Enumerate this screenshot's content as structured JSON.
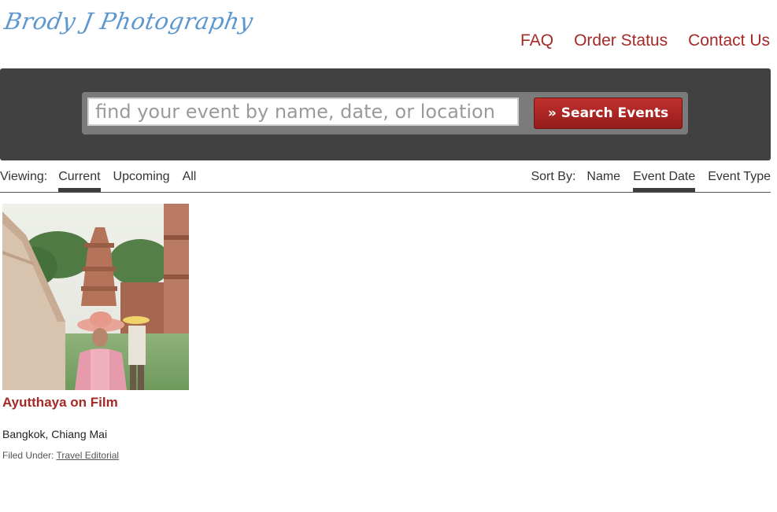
{
  "header": {
    "logo_text": "Brody J Photography",
    "nav": [
      "FAQ",
      "Order Status",
      "Contact Us"
    ]
  },
  "search": {
    "placeholder": "find your event by name, date, or location",
    "button_label": "» Search Events"
  },
  "filters": {
    "viewing_label": "Viewing:",
    "viewing_options": [
      "Current",
      "Upcoming",
      "All"
    ],
    "viewing_active": "Current",
    "sort_label": "Sort By:",
    "sort_options": [
      "Name",
      "Event Date",
      "Event Type"
    ],
    "sort_active": "Event Date"
  },
  "events": [
    {
      "title": "Ayutthaya on Film",
      "location": "Bangkok, Chiang Mai",
      "filed_label": "Filed Under:",
      "category": "Travel Editorial"
    }
  ],
  "colors": {
    "accent": "#a32a27",
    "logo": "#5c98cf",
    "banner": "#414141"
  }
}
